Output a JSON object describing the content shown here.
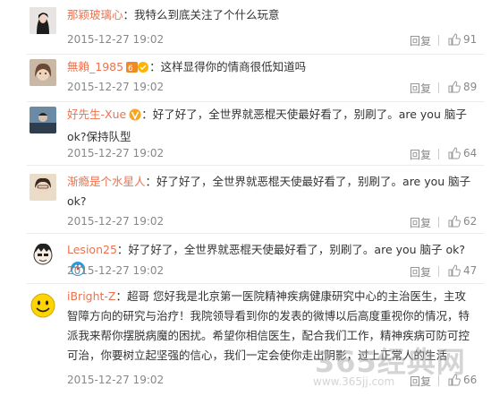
{
  "comments": [
    {
      "user": "那颖玻璃心",
      "sep": "：",
      "body": "我特么到底关注了个什么玩意",
      "time": "2015-12-27 19:02",
      "reply": "回复",
      "likes": "91"
    },
    {
      "user": "無賴_1985",
      "sep": "：",
      "body": "这样显得你的情商很低知道吗",
      "time": "2015-12-27 19:02",
      "reply": "回复",
      "likes": "89"
    },
    {
      "user": "好先生-Xue",
      "sep": "：",
      "body": "好了好了，全世界就恶棍天使最好看了，别刷了。are you 脑子 ok?保持队型",
      "time": "2015-12-27 19:02",
      "reply": "回复",
      "likes": "64"
    },
    {
      "user": "渐瘾是个水星人",
      "sep": "：",
      "body": "好了好了，全世界就恶棍天使最好看了，别刷了。are you 脑子 ok?",
      "time": "2015-12-27 19:02",
      "reply": "回复",
      "likes": "62"
    },
    {
      "user": "Lesion25",
      "sep": "：",
      "body": "好了好了，全世界就恶棍天使最好看了，别刷了。are you 脑子 ok?",
      "time": "2015-12-27 19:02",
      "reply": "回复",
      "likes": "47"
    },
    {
      "user": "iBright-Z",
      "sep": "：",
      "body": "超哥 您好我是北京第一医院精神疾病健康研究中心的主治医生，主攻智障方向的研究与治疗！我院领导看到你的发表的微博以后高度重视你的情况，特派我来帮你摆脱病魔的困扰。希望你相信医生，配合我们工作，精神疾病可防可控可治，你要树立起坚强的信心，我们一定会使你走出阴影，过上正常人的生活",
      "time": "2015-12-27 19:02",
      "reply": "回复",
      "likes": "66"
    }
  ],
  "watermark": {
    "text": "365经典网",
    "sub": "www.365jj.com"
  },
  "colors": {
    "username": "#eb7350",
    "meta": "#888888",
    "text": "#333333"
  }
}
